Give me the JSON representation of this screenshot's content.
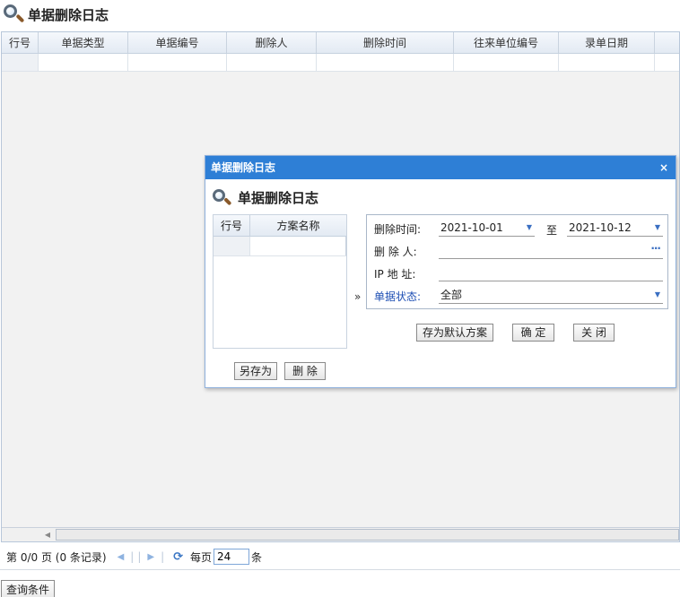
{
  "page": {
    "title": "单据删除日志"
  },
  "grid": {
    "columns": [
      "行号",
      "单据类型",
      "单据编号",
      "删除人",
      "删除时间",
      "往来单位编号",
      "录单日期"
    ]
  },
  "pager": {
    "page_info": "第 0/0 页  (0 条记录)",
    "per_page_label": "每页",
    "per_page_value": "24",
    "unit_label": "条"
  },
  "query_button": "查询条件",
  "dialog": {
    "title": "单据删除日志",
    "heading": "单据删除日志",
    "close": "×",
    "scheme_table": {
      "columns": [
        "行号",
        "方案名称"
      ]
    },
    "save_as_button": "另存为",
    "delete_button": "删 除",
    "expander": "»",
    "criteria": {
      "delete_time_label": "删除时间:",
      "date_from": "2021-10-01",
      "to_label": "至",
      "date_to": "2021-10-12",
      "deleter_label": "删 除 人:",
      "deleter_value": "",
      "ip_label": "IP 地  址:",
      "ip_value": "",
      "status_label": "单据状态:",
      "status_value": "全部"
    },
    "save_default_button": "存为默认方案",
    "ok_button": "确 定",
    "close_button": "关 闭"
  },
  "colors": {
    "dialog_titlebar": "#2e7fd6",
    "accent_blue": "#1e4fb4"
  },
  "icons": [
    "magnifier-icon",
    "dropdown-arrow-icon",
    "ellipsis-icon",
    "refresh-icon",
    "nav-arrow-icon"
  ]
}
